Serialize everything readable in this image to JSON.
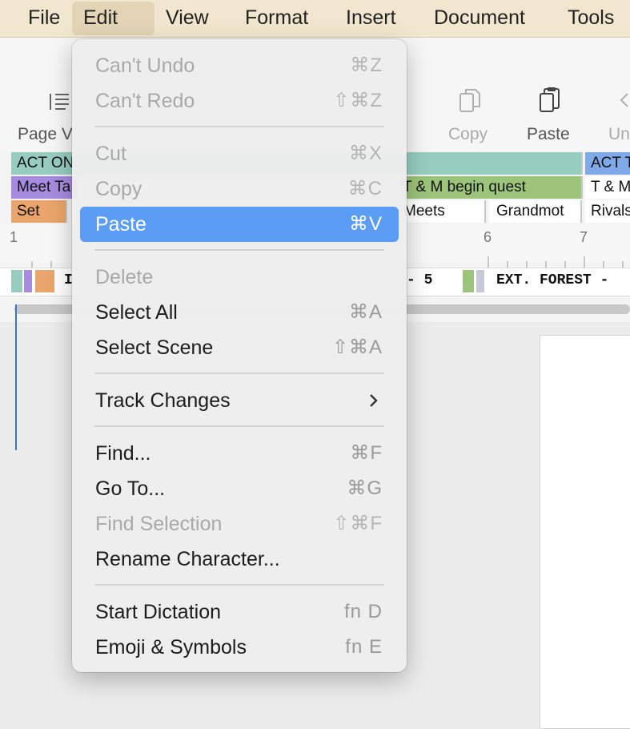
{
  "menubar": {
    "items": [
      "File",
      "Edit",
      "View",
      "Format",
      "Insert",
      "Document",
      "Tools"
    ],
    "active": "Edit"
  },
  "toolbar": {
    "page_view_label": "Page V",
    "copy_label": "Copy",
    "paste_label": "Paste",
    "undo_label": "Un"
  },
  "timeline": {
    "acts": [
      "ACT ON",
      "ACT T"
    ],
    "sequences": [
      "Meet Ta",
      "T & M begin quest",
      "T & M"
    ],
    "scenes_row": [
      "Set",
      "Meets",
      "Grandmot",
      "Rivals"
    ],
    "ruler": [
      "1",
      "6",
      "7"
    ],
    "scene_strip": [
      "I",
      "- 5",
      "EXT. FOREST -"
    ]
  },
  "edit_menu": {
    "undo": {
      "label": "Can't Undo",
      "shortcut": "⌘Z"
    },
    "redo": {
      "label": "Can't Redo",
      "shortcut": "⇧⌘Z"
    },
    "cut": {
      "label": "Cut",
      "shortcut": "⌘X"
    },
    "copy": {
      "label": "Copy",
      "shortcut": "⌘C"
    },
    "paste": {
      "label": "Paste",
      "shortcut": "⌘V"
    },
    "delete": {
      "label": "Delete"
    },
    "select_all": {
      "label": "Select All",
      "shortcut": "⌘A"
    },
    "select_scene": {
      "label": "Select Scene",
      "shortcut": "⇧⌘A"
    },
    "track_changes": {
      "label": "Track Changes"
    },
    "find": {
      "label": "Find...",
      "shortcut": "⌘F"
    },
    "go_to": {
      "label": "Go To...",
      "shortcut": "⌘G"
    },
    "find_selection": {
      "label": "Find Selection",
      "shortcut": "⇧⌘F"
    },
    "rename_character": {
      "label": "Rename Character..."
    },
    "start_dictation": {
      "label": "Start Dictation",
      "shortcut": "fn D"
    },
    "emoji_symbols": {
      "label": "Emoji & Symbols",
      "shortcut": "fn E"
    }
  },
  "colors": {
    "menubar_bg": "#f1e6ce",
    "highlight": "#5b9cf5",
    "act": "#97cdbf",
    "act2": "#7fa9e8",
    "sequence_purple": "#a78be0",
    "sequence_green": "#9cc47a",
    "scene_orange": "#e9a56b"
  }
}
